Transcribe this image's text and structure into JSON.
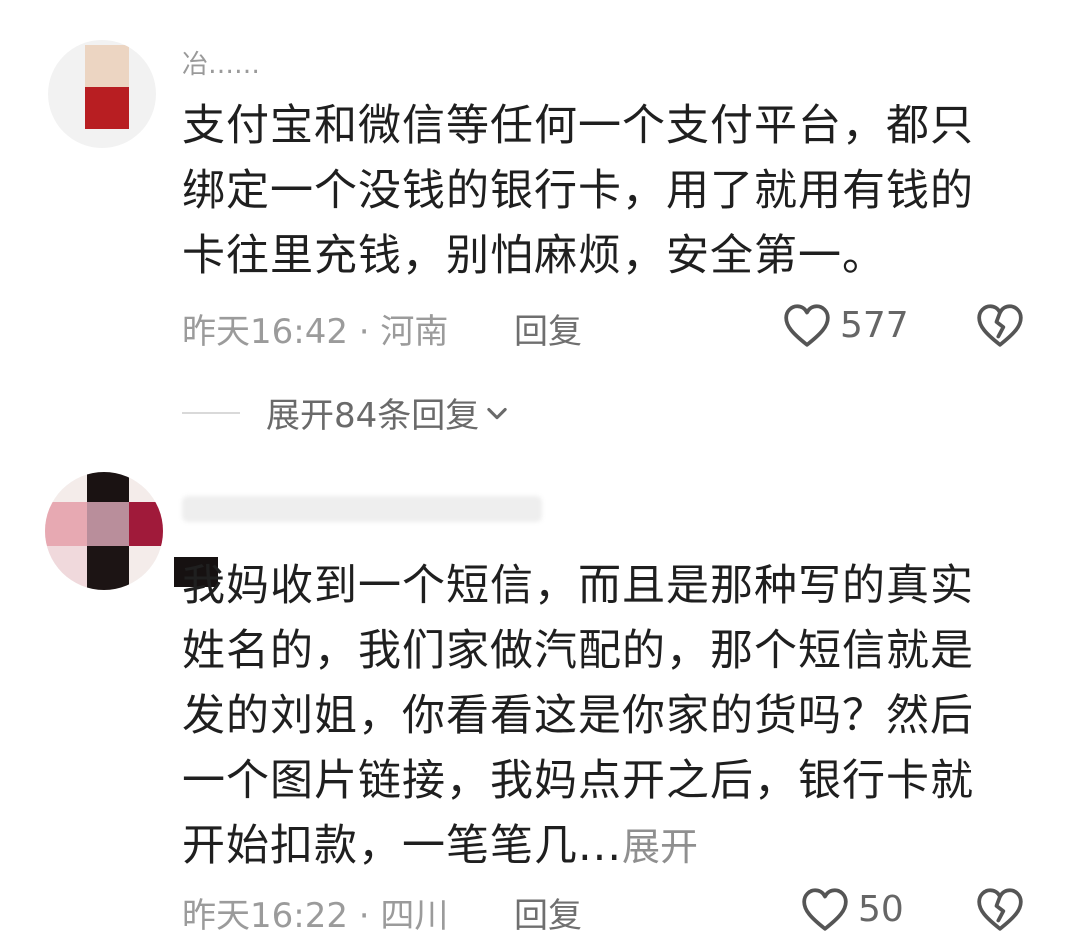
{
  "comments": [
    {
      "username": "冶……",
      "text": "支付宝和微信等任何一个支付平台，都只绑定一个没钱的银行卡，用了就用有钱的卡往里充钱，别怕麻烦，安全第一。",
      "time_location": "昨天16:42 · 河南",
      "reply_label": "回复",
      "like_count": "577",
      "expand_replies": "展开84条回复"
    },
    {
      "text": "我妈收到一个短信，而且是那种写的真实姓名的，我们家做汽配的，那个短信就是发的刘姐，你看看这是你家的货吗？然后一个图片链接，我妈点开之后，银行卡就开始扣款，一笔笔几...",
      "expand_label": "展开",
      "time_location": "昨天16:22 · 四川",
      "reply_label": "回复",
      "like_count": "50"
    }
  ],
  "icons": {
    "like": "heart-outline-icon",
    "dislike": "broken-heart-icon",
    "expand": "chevron-down-icon"
  },
  "colors": {
    "text": "#1f1f1f",
    "meta": "#9b9b9b",
    "icon": "#555555"
  }
}
